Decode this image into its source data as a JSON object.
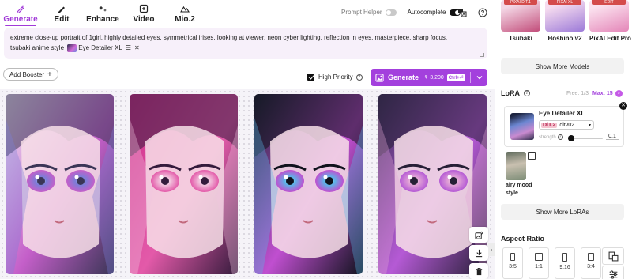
{
  "tabs": [
    {
      "label": "Generate",
      "icon": "pencil-sparkle-icon",
      "active": true
    },
    {
      "label": "Edit",
      "icon": "pen-icon",
      "active": false
    },
    {
      "label": "Enhance",
      "icon": "sparkle-icon",
      "active": false
    },
    {
      "label": "Video",
      "icon": "video-plus-icon",
      "active": false
    },
    {
      "label": "Mio.2",
      "icon": "mountain-icon",
      "active": false
    }
  ],
  "header": {
    "prompt_helper_label": "Prompt Helper",
    "prompt_helper_on": false,
    "autocomplete_label": "Autocomplete",
    "autocomplete_on": true
  },
  "prompt": {
    "line1": "extreme close-up portrait of 1girl, highly detailed eyes, symmetrical irises, looking at viewer, neon cyber lighting, reflection in eyes, masterpiece, sharp focus,",
    "line2": "tsubaki anime style",
    "chip_label": "Eye Detailer XL"
  },
  "actions": {
    "booster_label": "Add Booster",
    "high_priority_label": "High Priority",
    "high_priority_checked": true,
    "generate_label": "Generate",
    "generate_cost": "3,200",
    "generate_shortcut": "Ctrl+⏎"
  },
  "gallery": [
    {
      "name": "generated-image-1",
      "palette": [
        "#efe7f3",
        "#7a7ed8",
        "#c45fc9",
        "#3a3556"
      ]
    },
    {
      "name": "generated-image-2",
      "palette": [
        "#cf2f8a",
        "#f2c7df",
        "#e35aa9",
        "#341b3c"
      ]
    },
    {
      "name": "generated-image-3",
      "palette": [
        "#1f2435",
        "#5ab6e8",
        "#c04fd0",
        "#0f121c"
      ]
    },
    {
      "name": "generated-image-4",
      "palette": [
        "#3a2f55",
        "#e3a5d6",
        "#b55ad5",
        "#261f36"
      ]
    }
  ],
  "models": [
    {
      "name": "Tsubaki",
      "tag": "PIXAI DIT.1",
      "colors": [
        "#f4d8e6",
        "#c24d7a"
      ]
    },
    {
      "name": "Hoshino v2",
      "tag": "PIXAI XL",
      "colors": [
        "#f6dcef",
        "#9c7ad8"
      ]
    },
    {
      "name": "PixAI Edit Pro",
      "tag": "EDIT",
      "colors": [
        "#fbe2ef",
        "#e486b8"
      ]
    }
  ],
  "show_more_models": "Show More Models",
  "lora": {
    "title": "LoRA",
    "free": "Free: 1/3",
    "max": "Max: 15",
    "card": {
      "name": "Eye Detailer XL",
      "badge": "DiT.2",
      "version": "ditv02",
      "strength_label": "strength",
      "strength_value": "0.1",
      "strength_fraction": 0.1
    },
    "suggestion": "airy mood style",
    "show_more": "Show More LoRAs"
  },
  "aspect": {
    "title": "Aspect Ratio",
    "options": [
      {
        "label": "3:5",
        "w": 3,
        "h": 5
      },
      {
        "label": "1:1",
        "w": 1,
        "h": 1
      },
      {
        "label": "9:16",
        "w": 9,
        "h": 16
      },
      {
        "label": "3:4",
        "w": 3,
        "h": 4
      }
    ]
  },
  "colors": {
    "accent": "#a340dd",
    "tab_active": "#a13ad8",
    "prompt_bg": "#f7f0fa"
  }
}
